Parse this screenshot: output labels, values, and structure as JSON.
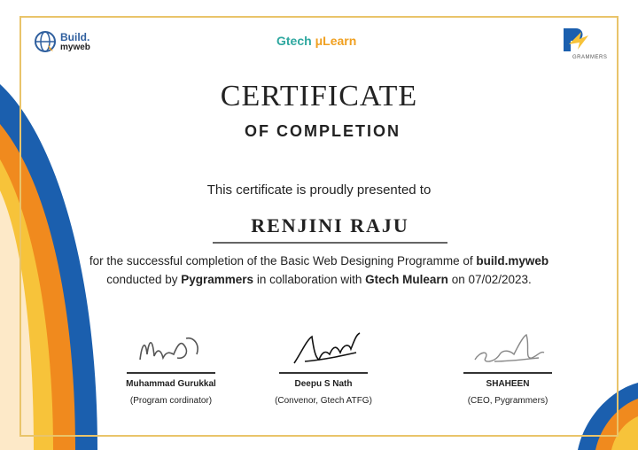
{
  "logos": {
    "build_line1": "Build.",
    "build_line2": "myweb",
    "gtech_prefix": "Gtech",
    "gtech_suffix": "μLearn",
    "pygrammers_caption": "GRAMMERS"
  },
  "certificate": {
    "title": "CERTIFICATE",
    "subtitle": "OF COMPLETION",
    "presented_to": "This certificate is proudly presented to",
    "recipient": "RENJINI RAJU",
    "body": {
      "part1": "for the successful completion of the Basic Web Designing Programme of ",
      "org1": "build.myweb",
      "part2": " conducted by ",
      "org2": "Pygrammers",
      "part3": " in collaboration with ",
      "org3": "Gtech Mulearn",
      "part4": " on 07/02/2023."
    }
  },
  "signatories": [
    {
      "name": "Muhammad Gurukkal",
      "role": "(Program cordinator)"
    },
    {
      "name": "Deepu S Nath",
      "role": "(Convenor, Gtech ATFG)"
    },
    {
      "name": "SHAHEEN",
      "role": "(CEO, Pygrammers)"
    }
  ],
  "colors": {
    "frame": "#e9c46a",
    "wave_blue": "#1b5fae",
    "wave_orange": "#f08a1e",
    "wave_yellow": "#f7c33a"
  }
}
